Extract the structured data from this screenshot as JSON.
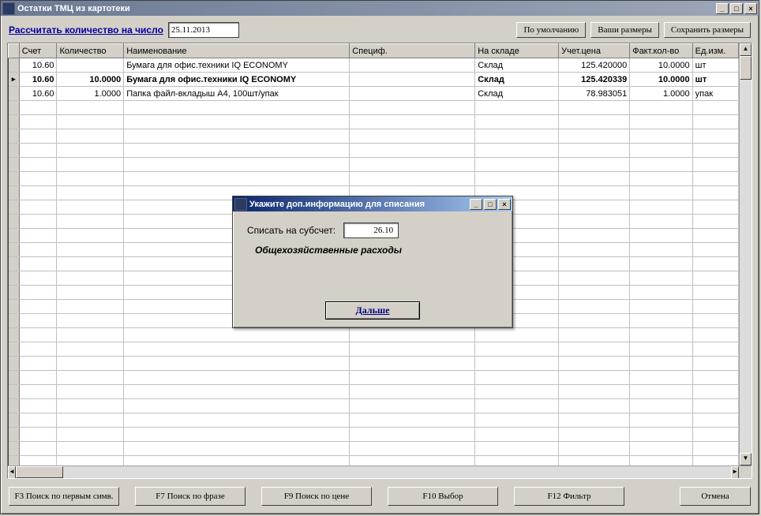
{
  "main_window": {
    "title": "Остатки ТМЦ из картотеки",
    "min_btn": "_",
    "max_btn": "□",
    "close_btn": "×"
  },
  "toolbar": {
    "calc_link": "Рассчитать количество на число",
    "date_value": "25.11.2013",
    "btn_default": "По умолчанию",
    "btn_your_sizes": "Ваши размеры",
    "btn_save_sizes": "Сохранить размеры"
  },
  "grid": {
    "headers": {
      "account": "Счет",
      "quantity": "Количество",
      "name": "Наименование",
      "spec": "Специф.",
      "warehouse": "На складе",
      "price": "Учет.цена",
      "fact_qty": "Факт.кол-во",
      "unit": "Ед.изм."
    },
    "rows": [
      {
        "marker": "",
        "account": "10.60",
        "quantity": "",
        "name": "Бумага для офис.техники IQ ECONOMY",
        "spec": "",
        "warehouse": "Склад",
        "price": "125.420000",
        "fact_qty": "10.0000",
        "unit": "шт"
      },
      {
        "marker": "▸",
        "account": "10.60",
        "quantity": "10.0000",
        "name": "Бумага для офис.техники IQ ECONOMY",
        "spec": "",
        "warehouse": "Склад",
        "price": "125.420339",
        "fact_qty": "10.0000",
        "unit": "шт"
      },
      {
        "marker": "",
        "account": "10.60",
        "quantity": "1.0000",
        "name": "Папка файл-вкладыш А4, 100шт/упак",
        "spec": "",
        "warehouse": "Склад",
        "price": "78.983051",
        "fact_qty": "1.0000",
        "unit": "упак"
      }
    ]
  },
  "fn": {
    "f3": "F3 Поиск по первым симв.",
    "f7": "F7 Поиск по фразе",
    "f9": "F9 Поиск по цене",
    "f10": "F10 Выбор",
    "f12": "F12 Фильтр",
    "cancel": "Отмена"
  },
  "dialog": {
    "title": "Укажите доп.информацию для списания",
    "label": "Списать на субсчет:",
    "value": "26.10",
    "desc": "Общехозяйственные расходы",
    "next_btn": "Дальше",
    "min_btn": "_",
    "max_btn": "□",
    "close_btn": "×"
  },
  "scroll": {
    "up": "▲",
    "down": "▼",
    "left": "◄",
    "right": "►"
  }
}
